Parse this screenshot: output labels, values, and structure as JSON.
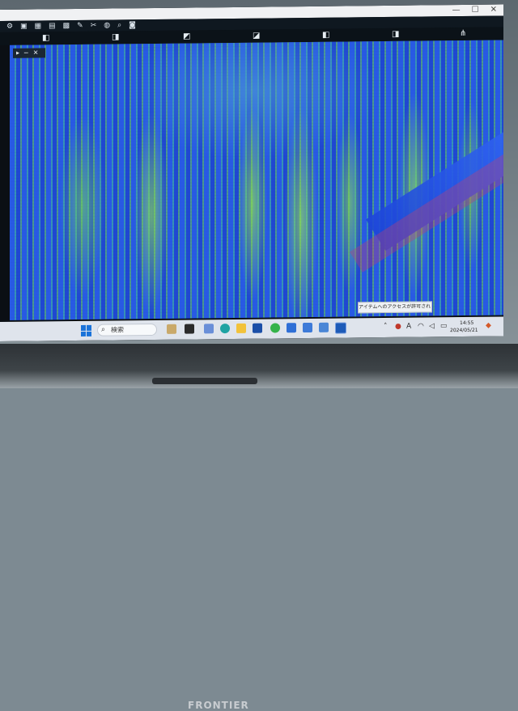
{
  "window": {
    "controls": {
      "minimize": "—",
      "maximize": "☐",
      "close": "✕"
    }
  },
  "toolbar": {
    "icons": [
      "gear-icon",
      "image-icon",
      "grid-icon",
      "layers-icon",
      "checker-icon",
      "pen-icon",
      "scissors-icon",
      "globe-icon",
      "search-icon",
      "camera-icon"
    ]
  },
  "viewer": {
    "float_controls": {
      "play": "▸",
      "minimize": "−",
      "close": "✕"
    },
    "colors": {
      "primary": "#2a5bd6",
      "highlight": "#96eb46",
      "accent": "#d83c6e"
    }
  },
  "toast": {
    "text": "アイテムへのアクセスが許可されません"
  },
  "taskbar": {
    "search_label": "検索",
    "clock_time": "14:55",
    "clock_date": "2024/05/21",
    "ime": "A"
  }
}
